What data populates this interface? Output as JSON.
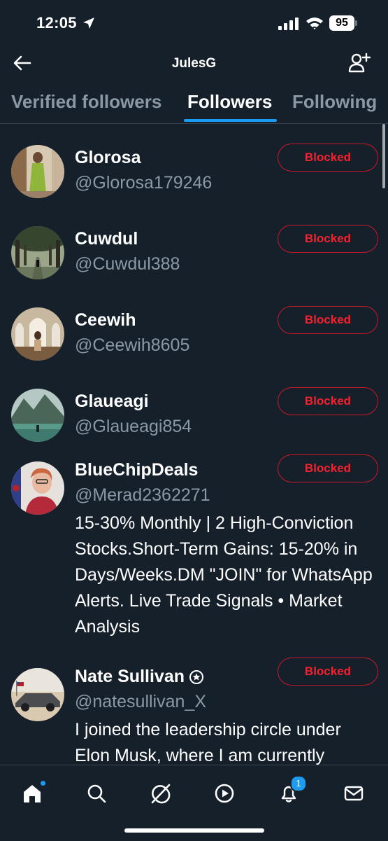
{
  "status_bar": {
    "time": "12:05",
    "battery": "95"
  },
  "header": {
    "title": "JulesG"
  },
  "tabs": [
    {
      "label": "Verified followers"
    },
    {
      "label": "Followers"
    },
    {
      "label": "Following"
    }
  ],
  "users": [
    {
      "name": "Glorosa",
      "handle": "@Glorosa179246",
      "button": "Blocked"
    },
    {
      "name": "Cuwdul",
      "handle": "@Cuwdul388",
      "button": "Blocked"
    },
    {
      "name": "Ceewih",
      "handle": "@Ceewih8605",
      "button": "Blocked"
    },
    {
      "name": "Glaueagi",
      "handle": "@Glaueagi854",
      "button": "Blocked"
    },
    {
      "name": "BlueChipDeals",
      "handle": "@Merad2362271",
      "button": "Blocked",
      "bio": "15-30% Monthly | 2 High-Conviction Stocks.Short-Term Gains: 15-20% in Days/Weeks.DM \"JOIN\" for WhatsApp Alerts. Live Trade Signals • Market Analysis"
    },
    {
      "name": "Nate Sullivan",
      "handle": "@natesullivan_X",
      "button": "Blocked",
      "bio": "I joined the leadership circle under Elon Musk, where I am currently"
    }
  ],
  "bottom_nav": {
    "items": [
      "home-icon",
      "search-icon",
      "grok-icon",
      "video-icon",
      "notifications-icon",
      "messages-icon"
    ],
    "notification_count": "1"
  },
  "colors": {
    "background": "#15202b",
    "accent": "#1d9bf0",
    "blocked": "#f4212e",
    "secondary_text": "#8b98a5"
  }
}
